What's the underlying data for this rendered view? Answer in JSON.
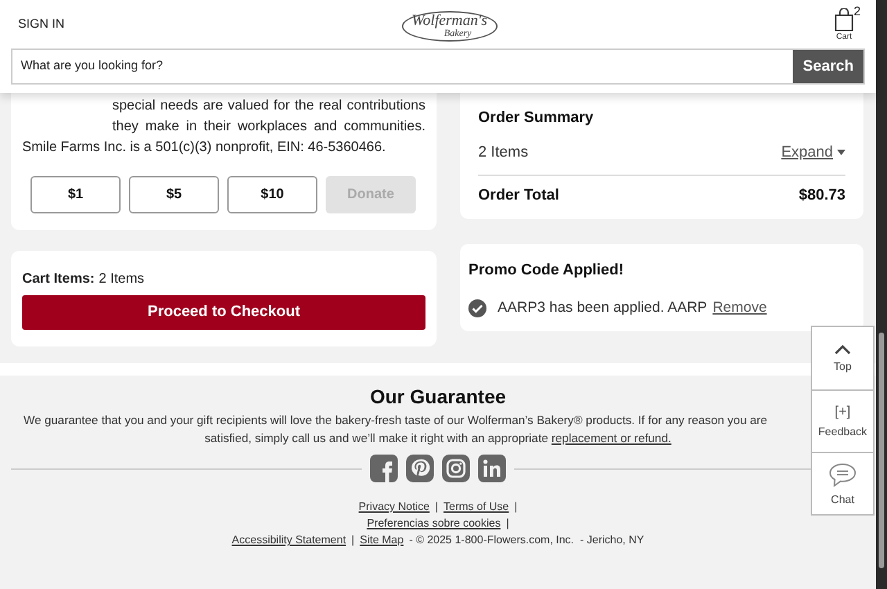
{
  "header": {
    "sign_in": "SIGN IN",
    "logo": {
      "name": "Wolferman's",
      "sub": "Bakery"
    },
    "cart": {
      "count": "2",
      "label": "Cart"
    }
  },
  "search": {
    "placeholder": "What are you looking for?",
    "button": "Search"
  },
  "donation": {
    "text": "special needs are valued for the real contributions they make in their workplaces and communities. Smile Farms Inc. is a 501(c)(3) nonprofit, EIN: 46-5360466.",
    "amounts": [
      {
        "label": "$1",
        "selected": false
      },
      {
        "label": "$5",
        "selected": false
      },
      {
        "label": "$10",
        "selected": false
      }
    ],
    "donate": {
      "label": "Donate",
      "disabled": true
    }
  },
  "cart_items": {
    "label": "Cart Items:",
    "value": "2 Items",
    "checkout": "Proceed to Checkout"
  },
  "order_summary": {
    "title": "Order Summary",
    "items": "2 Items",
    "expand": "Expand",
    "expanded": false,
    "total_label": "Order Total",
    "total": "$80.73"
  },
  "promo": {
    "title": "Promo Code Applied!",
    "message": "AARP3 has been applied. AARP",
    "remove": "Remove"
  },
  "guarantee": {
    "title": "Our Guarantee",
    "line_1": "We guarantee that you and your gift recipients will love the bakery-fresh taste of our Wolferman’s Bakery® products. If for any reason you are",
    "line_2": "satisfied, simply call us and we’ll make it right with an appropriate",
    "link": "replacement or refund."
  },
  "social": [
    {
      "kind": "facebook"
    },
    {
      "kind": "pinterest"
    },
    {
      "kind": "instagram"
    },
    {
      "kind": "linkedin"
    }
  ],
  "footer_lines": [
    [
      {
        "text": "Privacy Notice",
        "kind": "link"
      },
      {
        "text": "|",
        "kind": "text"
      },
      {
        "text": "Terms of Use",
        "kind": "link"
      },
      {
        "text": "|",
        "kind": "text"
      }
    ],
    [
      {
        "text": "Preferencias sobre cookies",
        "kind": "link"
      },
      {
        "text": "|",
        "kind": "text"
      }
    ],
    [
      {
        "text": "Accessibility Statement",
        "kind": "link"
      },
      {
        "text": "|",
        "kind": "text"
      },
      {
        "text": "Site Map",
        "kind": "link"
      },
      {
        "text": "- © 2025 1-800-Flowers.com, Inc.  - Jericho, NY",
        "kind": "text"
      }
    ]
  ],
  "side_widget": [
    {
      "kind": "top",
      "label": "Top"
    },
    {
      "kind": "feedback",
      "label": "Feedback",
      "icon": "[+]"
    },
    {
      "kind": "chat",
      "label": "Chat"
    }
  ]
}
